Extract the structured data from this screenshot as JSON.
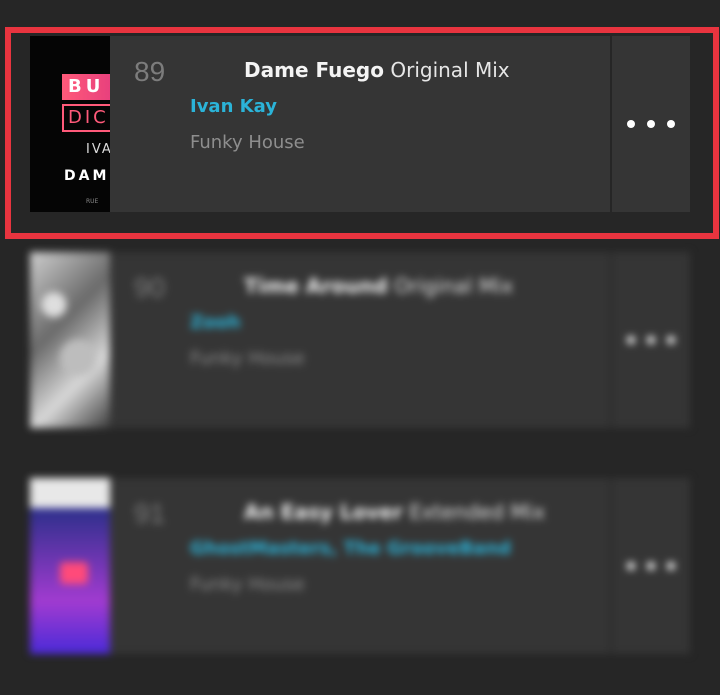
{
  "tracks": [
    {
      "number": "89",
      "title": "Dame Fuego",
      "mix": "Original Mix",
      "artist": "Ivan Kay",
      "genre": "Funky House",
      "artwork": {
        "line1": "BU",
        "line2": "DIC",
        "line3": "IVA",
        "line4": "DAM",
        "line5": "RUE"
      }
    },
    {
      "number": "90",
      "title": "Time Around",
      "mix": "Original Mix",
      "artist": "Zooh",
      "genre": "Funky House"
    },
    {
      "number": "91",
      "title": "An Easy Lover",
      "mix": "Extended Mix",
      "artist": "GhostMasters, The GrooveBand",
      "genre": "Funky House"
    }
  ],
  "menu_icon": "more-dots-icon",
  "colors": {
    "background": "#262626",
    "row": "#353535",
    "artist": "#2bb3d8",
    "genre": "#8e8e8e",
    "highlight": "#e8343f"
  }
}
